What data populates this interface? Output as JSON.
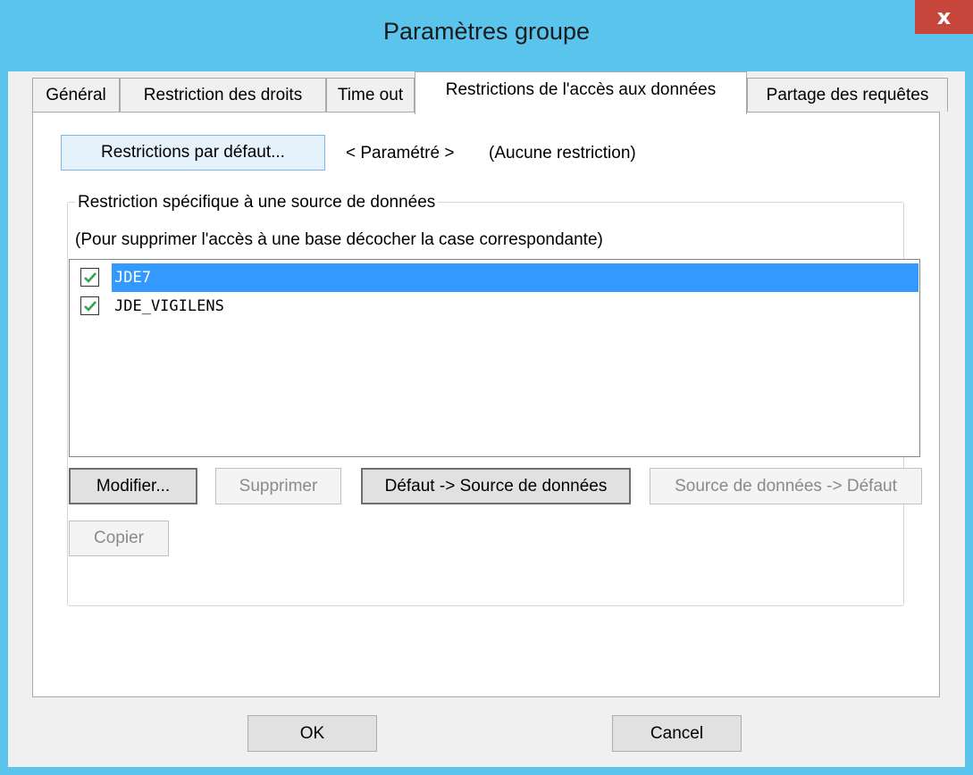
{
  "window": {
    "title": "Paramètres groupe",
    "close_label": "x"
  },
  "tabs": [
    {
      "label": "Général",
      "active": false
    },
    {
      "label": "Restriction des droits",
      "active": false
    },
    {
      "label": "Time out",
      "active": false
    },
    {
      "label": "Restrictions de l'accès aux données",
      "active": true
    },
    {
      "label": "Partage des requêtes",
      "active": false
    }
  ],
  "default_restrictions": {
    "button_label": "Restrictions par défaut...",
    "status_mode": "< Paramétré >",
    "status_value": "(Aucune restriction)"
  },
  "group": {
    "caption": "Restriction spécifique à une source de données",
    "hint": "(Pour supprimer l'accès à une base décocher la case correspondante)",
    "items": [
      {
        "label": "JDE7",
        "checked": true,
        "selected": true
      },
      {
        "label": "JDE_VIGILENS",
        "checked": true,
        "selected": false
      }
    ],
    "buttons": {
      "modify": "Modifier...",
      "delete": "Supprimer",
      "default_to_source": "Défaut -> Source de données",
      "source_to_default": "Source de données -> Défaut",
      "copy": "Copier"
    }
  },
  "dialog_buttons": {
    "ok": "OK",
    "cancel": "Cancel"
  },
  "colors": {
    "titlebar": "#5bc4ec",
    "close": "#c7463b",
    "selection": "#3399ff",
    "check": "#2ea84a"
  },
  "icons": {
    "close": "close-icon",
    "check": "checkmark-icon"
  }
}
